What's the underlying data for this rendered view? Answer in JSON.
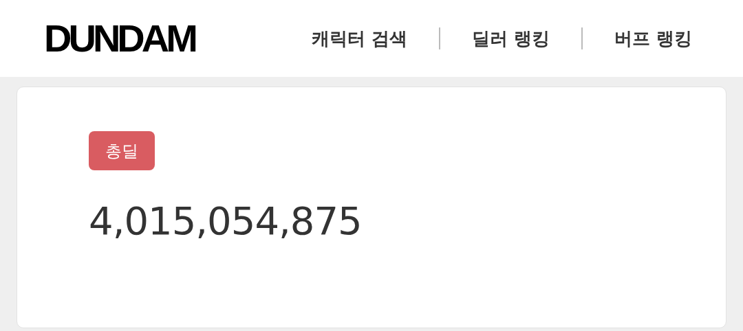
{
  "header": {
    "logo": "DUNDAM",
    "nav": [
      {
        "label": "캐릭터 검색"
      },
      {
        "label": "딜러 랭킹"
      },
      {
        "label": "버프 랭킹"
      }
    ]
  },
  "card": {
    "badge": "총딜",
    "value": "4,015,054,875"
  }
}
